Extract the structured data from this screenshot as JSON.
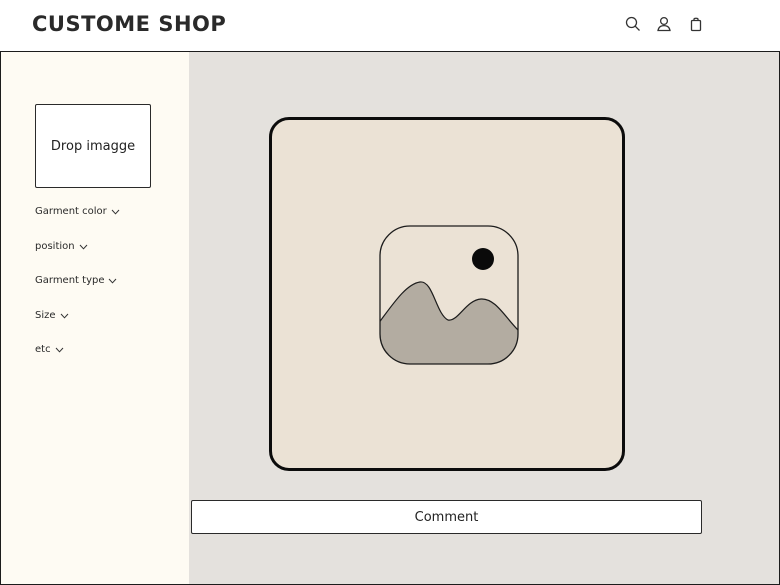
{
  "header": {
    "brand": "CUSTOME SHOP",
    "icons": [
      "search-icon",
      "user-icon",
      "shopping-bag-icon"
    ]
  },
  "sidebar": {
    "drop_label": "Drop imagge",
    "filters": [
      {
        "label": "Garment color",
        "icon": "chevron-down-icon"
      },
      {
        "label": "position",
        "icon": "chevron-down-icon"
      },
      {
        "label": "Garment type",
        "icon": "chevron-down-icon"
      },
      {
        "label": "Size",
        "icon": "chevron-down-icon"
      },
      {
        "label": "etc",
        "icon": "chevron-down-icon"
      }
    ]
  },
  "main": {
    "preview_icon": "image-placeholder-icon",
    "comment_label": "Comment"
  },
  "colors": {
    "sidebar_bg": "#fefbf3",
    "main_bg": "#e4e1dd",
    "preview_bg": "#ebe2d5",
    "mountains": "#b3aca1"
  }
}
